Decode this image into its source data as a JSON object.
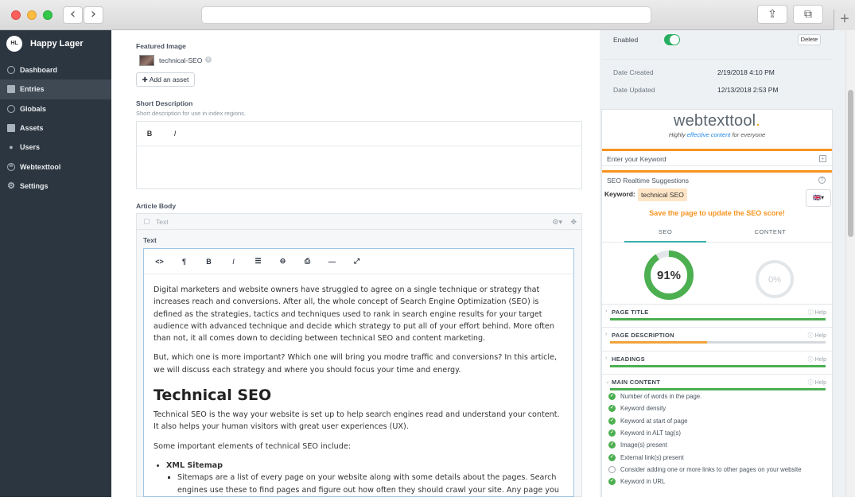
{
  "sidebar": {
    "brand_initials": "HL",
    "brand_name": "Happy Lager",
    "items": [
      {
        "label": "Dashboard",
        "icon": "dashboard-icon"
      },
      {
        "label": "Entries",
        "icon": "entries-icon"
      },
      {
        "label": "Globals",
        "icon": "globe-icon"
      },
      {
        "label": "Assets",
        "icon": "assets-icon"
      },
      {
        "label": "Users",
        "icon": "users-icon"
      },
      {
        "label": "Webtexttool",
        "icon": "webtexttool-icon"
      },
      {
        "label": "Settings",
        "icon": "gear-icon"
      }
    ]
  },
  "main": {
    "featured_image_label": "Featured Image",
    "asset_name": "technical-SEO",
    "add_asset_label": "Add an asset",
    "short_desc_label": "Short Description",
    "short_desc_hint": "Short description for use in index regions.",
    "bold": "B",
    "italic": "I",
    "article_body_label": "Article Body",
    "block_type": "Text",
    "text_label": "Text",
    "paragraphs": [
      "Digital marketers and website owners have struggled to agree on a single technique or strategy that increases reach and conversions. After all, the whole concept of Search Engine Optimization (SEO) is defined as the strategies, tactics and techniques used to rank in search engine results for your target audience with advanced technique and decide which strategy to put all of your effort behind. More often than not, it all comes down to deciding between technical SEO and content marketing.",
      "But, which one is more important? Which one will bring you modre traffic and conversions? In this article, we will discuss each strategy and where you should focus your time and energy."
    ],
    "heading": "Technical SEO",
    "paragraphs2": [
      "Technical SEO is the way your website is set up to help search engines read and understand your content. It also helps your human visitors with great user experiences (UX).",
      "Some important elements of technical SEO include:"
    ],
    "list_item": "XML Sitemap",
    "sublist_item": "Sitemaps are a list of every page on your website along with some details about the pages. Search engines use these to find pages and figure out how often they should crawl your site. Any page you want"
  },
  "right": {
    "enabled_label": "Enabled",
    "delete_label": "Delete",
    "date_created_label": "Date Created",
    "date_created": "2/19/2018 4:10 PM",
    "date_updated_label": "Date Updated",
    "date_updated": "12/13/2018 2:53 PM",
    "wtt_name_a": "webtexttool",
    "wtt_name_dot": ".",
    "wtt_tag_a": "Highly ",
    "wtt_tag_b": "effective content",
    "wtt_tag_c": " for everyone",
    "keyword_placeholder": "Enter your Keyword",
    "suggestions_label": "SEO Realtime Suggestions",
    "keyword_label": "Keyword:",
    "keyword_value": "technical SEO",
    "save_message": "Save the page to update the SEO score!",
    "tab_seo": "SEO",
    "tab_content": "CONTENT",
    "seo_score": "91%",
    "seo_score_value": 91,
    "content_score": "0%",
    "content_score_value": 0,
    "help_label": "Help",
    "sections": [
      {
        "title": "PAGE TITLE",
        "progress": 100,
        "color": "#4caf50"
      },
      {
        "title": "PAGE DESCRIPTION",
        "progress": 45,
        "color": "#f0a33c"
      },
      {
        "title": "HEADINGS",
        "progress": 100,
        "color": "#4caf50"
      },
      {
        "title": "MAIN CONTENT",
        "progress": 100,
        "color": "#4caf50"
      }
    ],
    "checks": [
      {
        "label": "Number of words in the page.",
        "ok": true
      },
      {
        "label": "Keyword density",
        "ok": true
      },
      {
        "label": "Keyword at start of page",
        "ok": true
      },
      {
        "label": "Keyword in ALT tag(s)",
        "ok": true
      },
      {
        "label": "Image(s) present",
        "ok": true
      },
      {
        "label": "External link(s) present",
        "ok": true
      },
      {
        "label": "Consider adding one or more links to other pages on your website",
        "ok": false
      },
      {
        "label": "Keyword in URL",
        "ok": true
      }
    ]
  },
  "colors": {
    "sidebar": "#2c3640",
    "accent_green": "#4caf50",
    "accent_orange": "#f7931e"
  }
}
